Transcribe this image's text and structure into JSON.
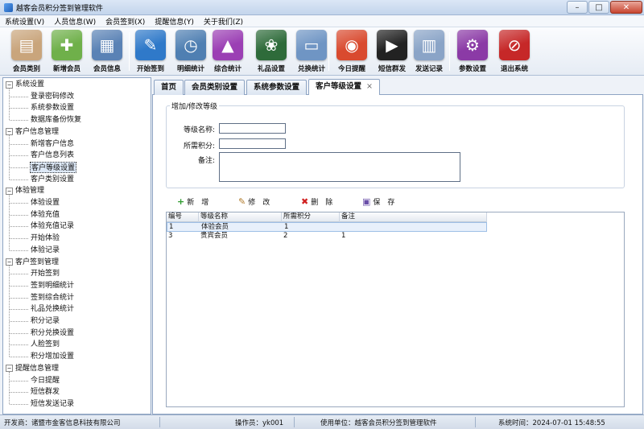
{
  "window": {
    "title": "越客会员积分签到管理软件"
  },
  "menu": [
    "系统设置(V)",
    "人员信息(W)",
    "会员签到(X)",
    "提醒信息(Y)",
    "关于我们(Z)"
  ],
  "toolbar": [
    {
      "label": "会员类别",
      "icon": "member-category-icon",
      "color": "#c9a57c"
    },
    {
      "label": "新增会员",
      "icon": "add-member-icon",
      "color": "#6fb04a"
    },
    {
      "label": "会员信息",
      "icon": "member-info-icon",
      "color": "#5a82b5"
    },
    {
      "label": "开始签到",
      "icon": "pencil-signin-icon",
      "color": "#2f79c9"
    },
    {
      "label": "明细统计",
      "icon": "clock-stat-icon",
      "color": "#4f7fb2"
    },
    {
      "label": "综合统计",
      "icon": "chart-stat-icon",
      "color": "#9b3fb4"
    },
    {
      "label": "礼品设置",
      "icon": "gift-icon",
      "color": "#2e6b3a"
    },
    {
      "label": "兑换统计",
      "icon": "folder-exchange-icon",
      "color": "#6f95c4"
    },
    {
      "label": "今日提醒",
      "icon": "chrome-reminder-icon",
      "color": "#d94a2f"
    },
    {
      "label": "短信群发",
      "icon": "terminal-sms-icon",
      "color": "#222222"
    },
    {
      "label": "发送记录",
      "icon": "document-log-icon",
      "color": "#8aa4c7"
    },
    {
      "label": "参数设置",
      "icon": "gear-icon",
      "color": "#8b3aa6"
    },
    {
      "label": "退出系统",
      "icon": "exit-icon",
      "color": "#c62828"
    }
  ],
  "tree": [
    {
      "label": "系统设置",
      "children": [
        "登录密码修改",
        "系统参数设置",
        "数据库备份恢复"
      ]
    },
    {
      "label": "客户信息管理",
      "children": [
        "新增客户信息",
        "客户信息列表",
        "客户等级设置",
        "客户类别设置"
      ]
    },
    {
      "label": "体验管理",
      "children": [
        "体验设置",
        "体验充值",
        "体验充值记录",
        "开始体验",
        "体验记录"
      ]
    },
    {
      "label": "客户签到管理",
      "children": [
        "开始签到",
        "签到明细统计",
        "签到综合统计",
        "礼品兑换统计",
        "积分记录",
        "积分兑换设置",
        "人脸签到",
        "积分增加设置"
      ]
    },
    {
      "label": "提醒信息管理",
      "children": [
        "今日提醒",
        "短信群发",
        "短信发送记录"
      ]
    }
  ],
  "tree_selected": "客户等级设置",
  "tree_expander": "−",
  "tabs": [
    "首页",
    "会员类别设置",
    "系统参数设置",
    "客户等级设置"
  ],
  "tab_close": "×",
  "form": {
    "legend": "增加/修改等级",
    "name_label": "等级名称:",
    "name_value": "",
    "points_label": "所需积分:",
    "points_value": "",
    "note_label": "备注:",
    "note_value": ""
  },
  "actions": [
    {
      "label": "新　增",
      "icon": "+",
      "color": "#2e9b2e"
    },
    {
      "label": "修　改",
      "icon": "✎",
      "color": "#b07a2a"
    },
    {
      "label": "删　除",
      "icon": "✖",
      "color": "#d02020"
    },
    {
      "label": "保　存",
      "icon": "▣",
      "color": "#6a4fa8"
    }
  ],
  "grid": {
    "columns": [
      "编号",
      "等级名称",
      "所需积分",
      "备注"
    ],
    "rows": [
      [
        "1",
        "体验会员",
        "1",
        ""
      ],
      [
        "3",
        "贵宾会员",
        "2",
        "1"
      ]
    ]
  },
  "status": {
    "developer": "开发商：诸暨市金客信息科技有限公司",
    "operator": "操作员：yk001",
    "unit": "使用单位：越客会员积分签到管理软件",
    "time": "系统时间：2024-07-01 15:48:55"
  }
}
